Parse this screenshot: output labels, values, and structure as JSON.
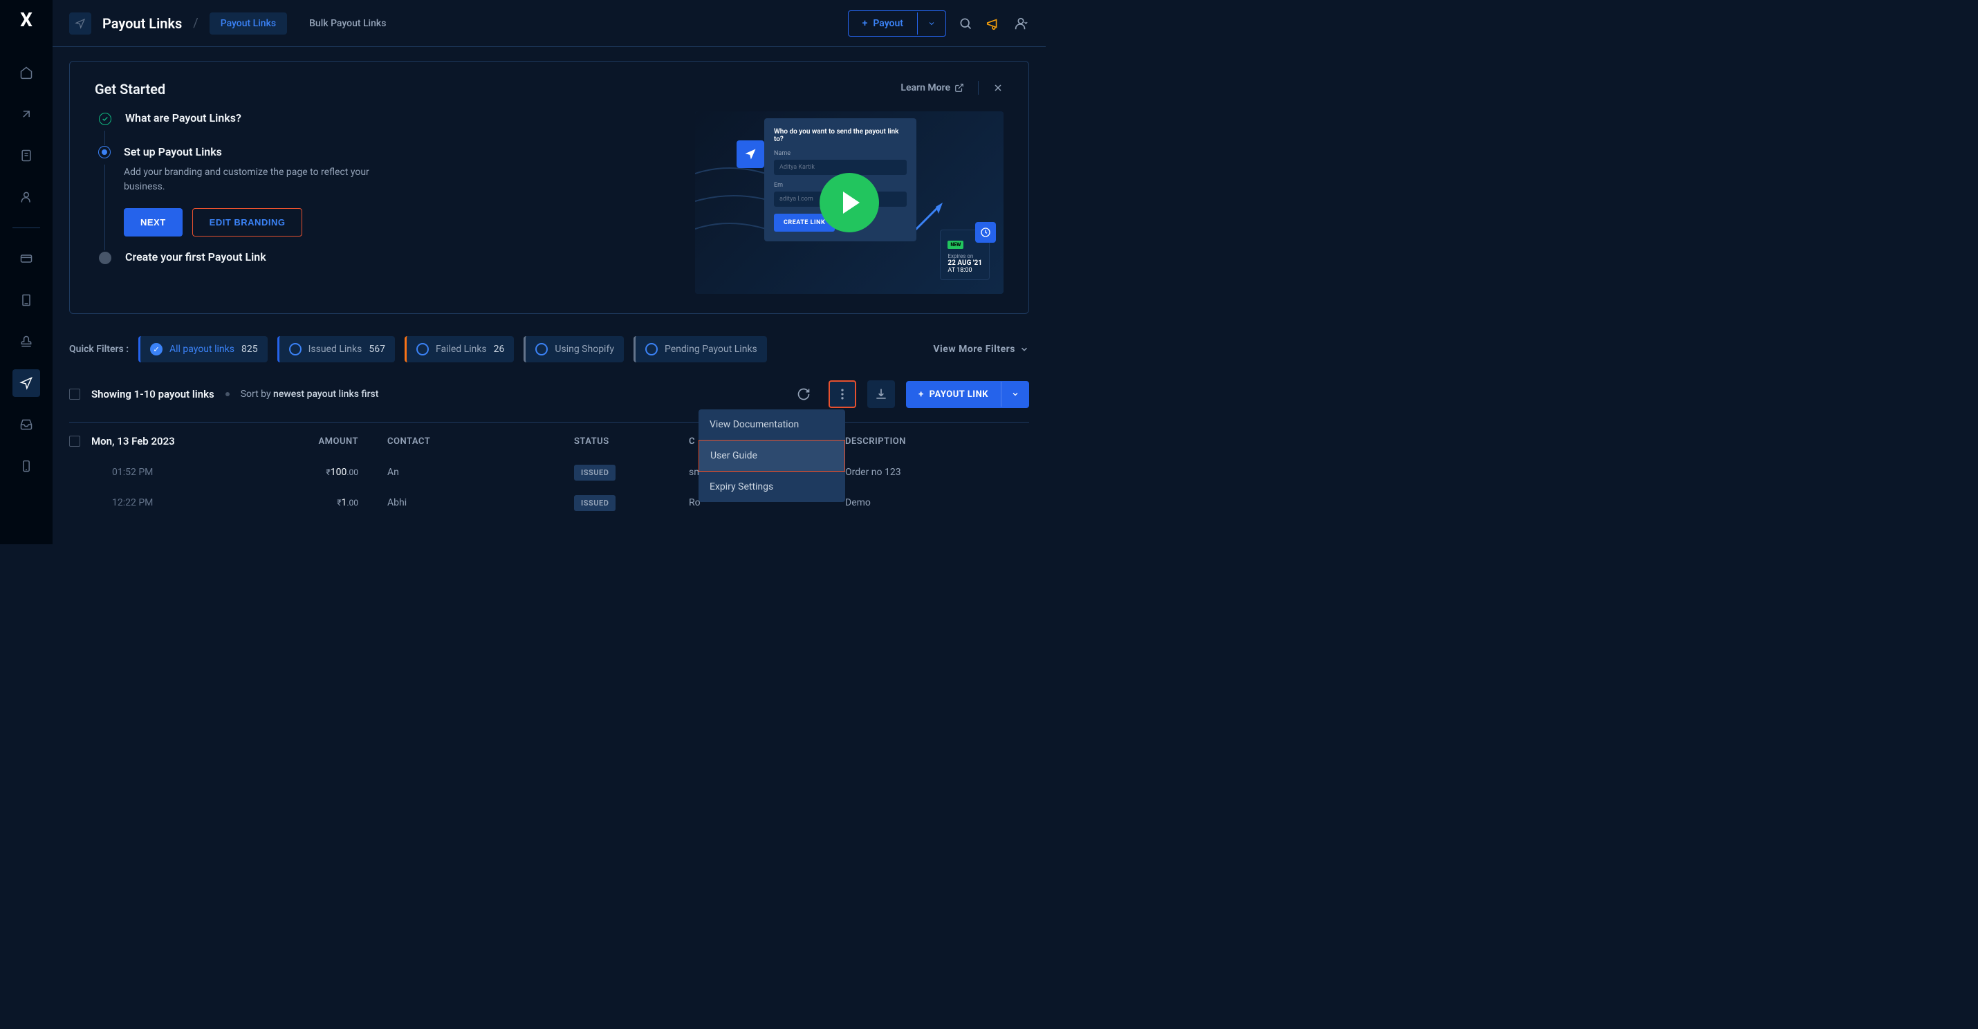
{
  "header": {
    "page_title": "Payout Links",
    "tabs": [
      "Payout Links",
      "Bulk Payout Links"
    ],
    "payout_button": "Payout"
  },
  "getstarted": {
    "title": "Get Started",
    "learn_more": "Learn More",
    "steps": [
      {
        "title": "What are Payout Links?"
      },
      {
        "title": "Set up Payout Links",
        "desc": "Add your branding and customize the page to reflect your business.",
        "next": "NEXT",
        "edit": "EDIT BRANDING"
      },
      {
        "title": "Create your first Payout Link"
      }
    ],
    "video": {
      "question": "Who do you want to send the payout link to?",
      "name_label": "Name",
      "name_value": "Aditya Kartik",
      "em_label": "Em",
      "em_value": "aditya              l.com",
      "create": "CREATE LINK",
      "new_tag": "NEW",
      "expires_label": "Expires on",
      "expires_date": "22 AUG '21",
      "expires_time": "AT 18:00"
    }
  },
  "filters": {
    "label": "Quick Filters :",
    "items": [
      {
        "name": "All payout links",
        "count": "825",
        "checked": true
      },
      {
        "name": "Issued Links",
        "count": "567"
      },
      {
        "name": "Failed Links",
        "count": "26"
      },
      {
        "name": "Using Shopify",
        "count": ""
      },
      {
        "name": "Pending Payout Links",
        "count": ""
      }
    ],
    "view_more": "View More Filters"
  },
  "table": {
    "showing": "Showing 1-10 payout links",
    "sort_prefix": "Sort by ",
    "sort_value": "newest payout links first",
    "menu": [
      "View Documentation",
      "User Guide",
      "Expiry Settings"
    ],
    "payout_link_btn": "PAYOUT LINK",
    "date_group": "Mon, 13 Feb 2023",
    "cols": {
      "amount": "AMOUNT",
      "contact": "CONTACT",
      "status": "STATUS",
      "c": "C",
      "desc": "DESCRIPTION"
    },
    "rows": [
      {
        "time": "01:52 PM",
        "amount_int": "100",
        "amount_dec": ".00",
        "contact": "An",
        "status": "ISSUED",
        "c": "sm",
        "desc": "Order no 123"
      },
      {
        "time": "12:22 PM",
        "amount_int": "1",
        "amount_dec": ".00",
        "contact": "Abhi",
        "status": "ISSUED",
        "c": "Ro",
        "desc": "Demo"
      }
    ]
  }
}
